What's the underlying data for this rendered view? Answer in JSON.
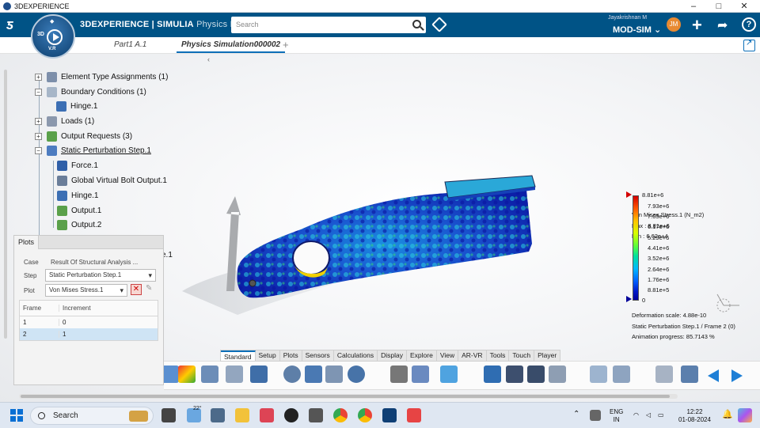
{
  "window": {
    "title": "3DEXPERIENCE",
    "controls": [
      "–",
      "□",
      "✕"
    ]
  },
  "topbar": {
    "brand_bold": "3D",
    "brand_rest": "EXPERIENCE | SIMULIA",
    "brand_app": "Physics R...",
    "search_placeholder": "Search",
    "user_name": "Jayakrishnan M",
    "context": "MOD-SIM",
    "avatar_initials": "JM"
  },
  "compass": {
    "label_3d": "3D",
    "label_vr": "V.R"
  },
  "tabs": [
    {
      "label": "Part1 A.1"
    },
    {
      "label": "Physics Simulation000002"
    }
  ],
  "tree": {
    "items": [
      {
        "label": "Element Type Assignments (1)"
      },
      {
        "label": "Boundary Conditions (1)"
      },
      {
        "label": "Hinge.1"
      },
      {
        "label": "Loads (1)"
      },
      {
        "label": "Output Requests (3)"
      },
      {
        "label": "Static Perturbation Step.1"
      },
      {
        "label": "Force.1"
      },
      {
        "label": "Global Virtual Bolt Output.1"
      },
      {
        "label": "Hinge.1"
      },
      {
        "label": "Output.1"
      },
      {
        "label": "Output.2"
      }
    ],
    "partial_label": "e.1"
  },
  "plots": {
    "title": "Plots",
    "case_label": "Case",
    "case_value": "Result Of Structural Analysis ...",
    "step_label": "Step",
    "step_value": "Static Perturbation Step.1",
    "plot_label": "Plot",
    "plot_value": "Von Mises Stress.1",
    "col_frame": "Frame",
    "col_increment": "Increment",
    "rows": [
      {
        "frame": "1",
        "increment": "0"
      },
      {
        "frame": "2",
        "increment": "1"
      }
    ]
  },
  "legend": {
    "title": "Von Mises Stress.1 (N_m2)",
    "max": "Max : 8.81e+6",
    "min": "Min : 6.62e+4",
    "ticks": [
      "8.81e+6",
      "7.93e+6",
      "7.05e+6",
      "6.17e+6",
      "5.29e+6",
      "4.41e+6",
      "3.52e+6",
      "2.64e+6",
      "1.76e+6",
      "8.81e+5",
      "0"
    ],
    "colors": {
      "high": "#d40000",
      "low": "#00009a"
    }
  },
  "info": {
    "deformation": "Deformation scale: 4.88e-10",
    "frame": "Static Perturbation Step.1 / Frame 2 (0)",
    "animation": "Animation progress: 85.7143 %"
  },
  "action_tabs": [
    "Standard",
    "Setup",
    "Plots",
    "Sensors",
    "Calculations",
    "Display",
    "Explore",
    "View",
    "AR-VR",
    "Tools",
    "Touch",
    "Player"
  ],
  "taskbar": {
    "search": "Search",
    "weather": "22°",
    "lang": "ENG",
    "region": "IN",
    "time": "12:22",
    "date": "01-08-2024"
  }
}
